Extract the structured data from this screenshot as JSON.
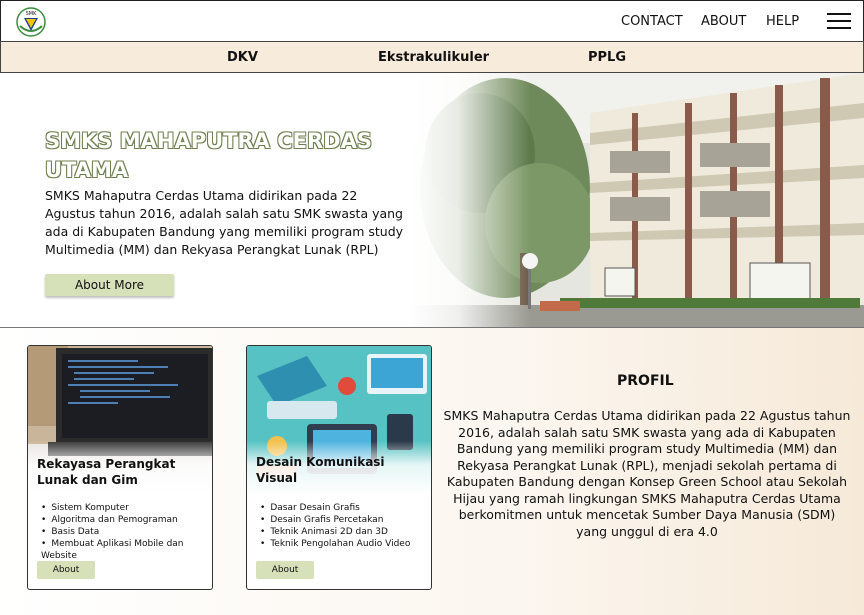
{
  "header": {
    "logo_text": "SMK",
    "nav": [
      "CONTACT",
      "ABOUT",
      "HELP"
    ]
  },
  "subnav": [
    "DKV",
    "Ekstrakulikuler",
    "PPLG"
  ],
  "hero": {
    "title": "SMKS MAHAPUTRA CERDAS UTAMA",
    "description": "SMKS Mahaputra Cerdas Utama didirikan pada 22 Agustus tahun 2016, adalah salah satu SMK swasta yang ada di Kabupaten Bandung yang memiliki program study Multimedia (MM) dan Rekyasa Perangkat Lunak (RPL)",
    "button": "About More"
  },
  "cards": [
    {
      "title": "Rekayasa Perangkat Lunak dan Gim",
      "items": [
        "Sistem Komputer",
        "Algoritma dan Pemograman",
        "Basis Data",
        "Membuat Aplikasi Mobile dan Website"
      ],
      "button": "About"
    },
    {
      "title": "Desain Komunikasi Visual",
      "items": [
        "Dasar Desain Grafis",
        "Desain Grafis Percetakan",
        "Teknik Animasi 2D dan 3D",
        "Teknik Pengolahan Audio Video"
      ],
      "button": "About"
    }
  ],
  "profil": {
    "title": "PROFIL",
    "text": "SMKS Mahaputra Cerdas Utama didirikan pada 22 Agustus tahun 2016, adalah salah satu SMK swasta yang ada di Kabupaten Bandung yang memiliki program study Multimedia (MM) dan Rekyasa Perangkat Lunak (RPL), menjadi sekolah pertama di Kabupaten Bandung dengan Konsep Green School atau Sekolah Hijau yang ramah lingkungan SMKS Mahaputra Cerdas Utama berkomitmen untuk mencetak Sumber Daya Manusia (SDM) yang unggul di era 4.0"
  },
  "colors": {
    "accent_button": "#d6e0b9",
    "subnav_bg": "#f7ebdc",
    "title_outline": "#6e7f4d"
  }
}
